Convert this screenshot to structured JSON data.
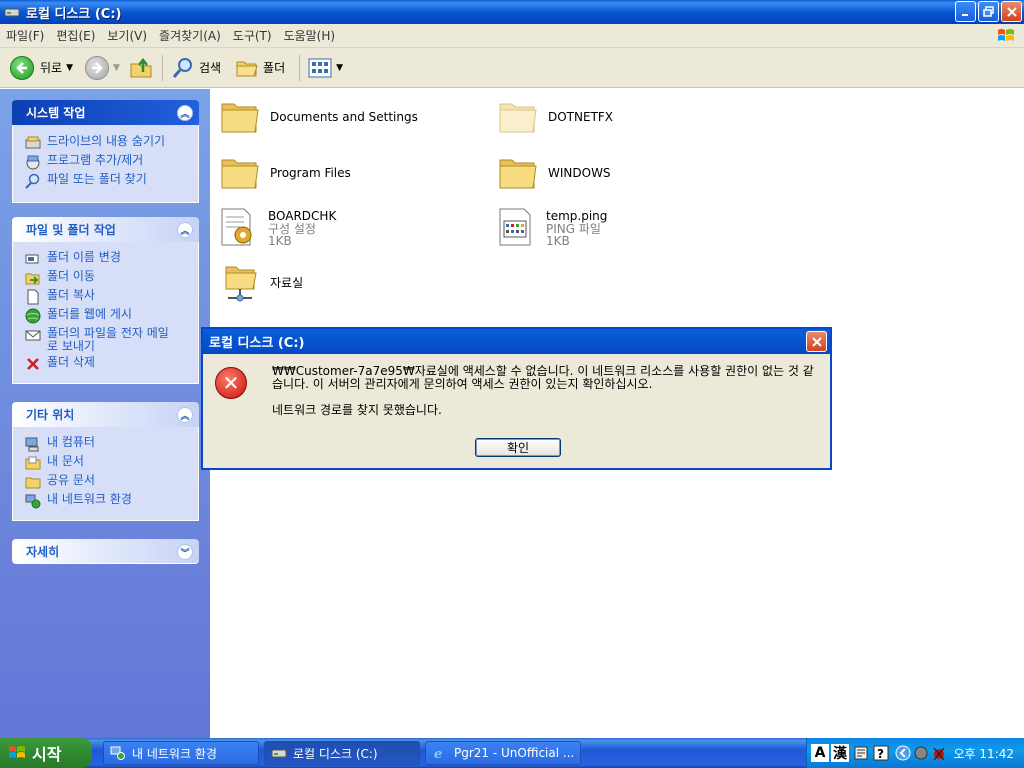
{
  "window": {
    "title": "로컬 디스크 (C:)"
  },
  "menubar": {
    "items": [
      "파일(F)",
      "편집(E)",
      "보기(V)",
      "즐겨찾기(A)",
      "도구(T)",
      "도움말(H)"
    ]
  },
  "toolbar": {
    "back_label": "뒤로",
    "search_label": "검색",
    "folders_label": "폴더"
  },
  "leftpane": {
    "system_tasks": {
      "title": "시스템 작업",
      "items": [
        "드라이브의 내용 숨기기",
        "프로그램 추가/제거",
        "파일 또는 폴더 찾기"
      ]
    },
    "file_tasks": {
      "title": "파일 및 폴더 작업",
      "items": [
        "폴더 이름 변경",
        "폴더 이동",
        "폴더 복사",
        "폴더를 웹에 게시",
        "폴더의 파일을 전자 메일로 보내기",
        "폴더 삭제"
      ]
    },
    "other_places": {
      "title": "기타 위치",
      "items": [
        "내 컴퓨터",
        "내 문서",
        "공유 문서",
        "내 네트워크 환경"
      ]
    },
    "details": {
      "title": "자세히"
    }
  },
  "files": [
    {
      "name": "Documents and Settings"
    },
    {
      "name": "DOTNETFX"
    },
    {
      "name": "Program Files"
    },
    {
      "name": "WINDOWS"
    },
    {
      "name": "BOARDCHK",
      "type": "구성 설정",
      "size": "1KB"
    },
    {
      "name": "temp.ping",
      "type": "PING 파일",
      "size": "1KB"
    },
    {
      "name": "자료실"
    }
  ],
  "dialog": {
    "title": "로컬 디스크 (C:)",
    "message1": "₩₩Customer-7a7e95₩자료실에 액세스할 수 없습니다. 이 네트워크 리소스를 사용할 권한이 없는 것 같습니다. 이 서버의 관리자에게 문의하여 액세스 권한이 있는지 확인하십시오.",
    "message2": "네트워크 경로를 찾지 못했습니다.",
    "ok_label": "확인"
  },
  "taskbar": {
    "start_label": "시작",
    "buttons": [
      "내 네트워크 환경",
      "로컬 디스크 (C:)",
      "Pgr21 - UnOfficial ..."
    ],
    "ime_label": "A",
    "hanja_label": "漢",
    "clock": "오후 11:42"
  }
}
